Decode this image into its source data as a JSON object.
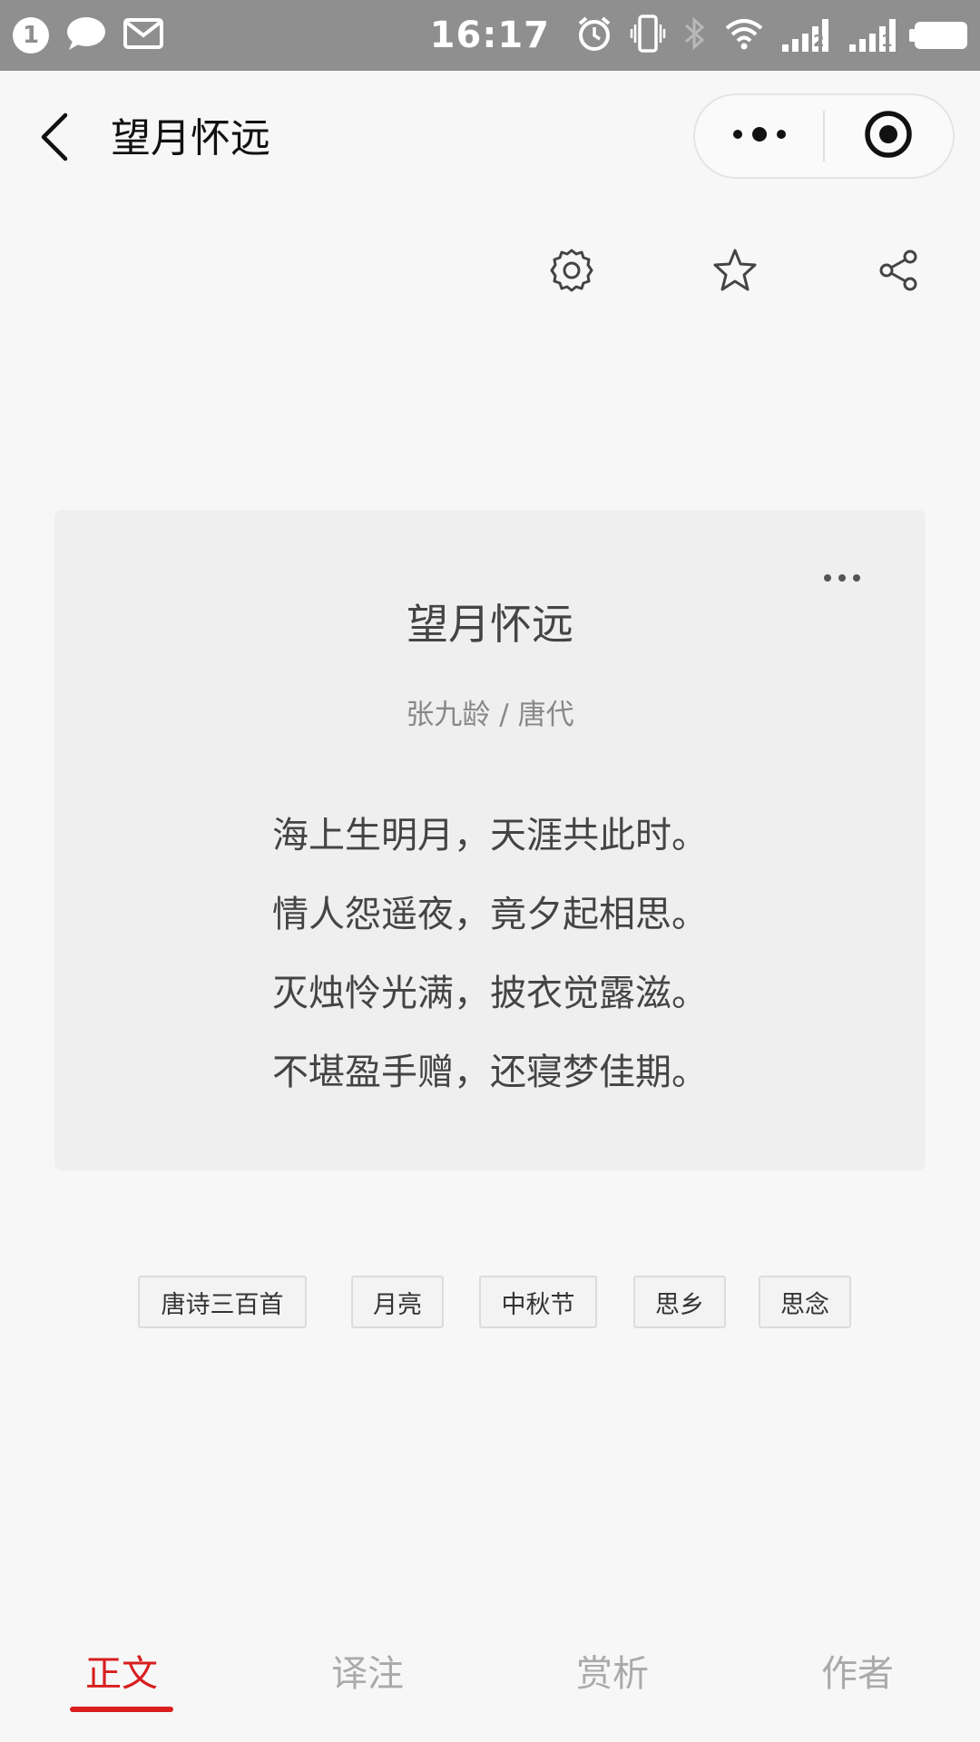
{
  "status_bar": {
    "notification_count": "1",
    "time": "16:17",
    "sim2_label": "2",
    "sim1_label": "1"
  },
  "nav": {
    "title": "望月怀远"
  },
  "poem": {
    "title": "望月怀远",
    "author_line": "张九龄 / 唐代",
    "lines": [
      "海上生明月，天涯共此时。",
      "情人怨遥夜，竟夕起相思。",
      "灭烛怜光满，披衣觉露滋。",
      "不堪盈手赠，还寝梦佳期。"
    ]
  },
  "tags": [
    "唐诗三百首",
    "月亮",
    "中秋节",
    "思乡",
    "思念"
  ],
  "tabs": {
    "items": [
      "正文",
      "译注",
      "赏析",
      "作者"
    ],
    "active": "正文"
  },
  "colors": {
    "accent": "#d81e1e",
    "status_bar": "#8f8f8f",
    "background": "#f7f7f7",
    "card": "#efefef"
  }
}
